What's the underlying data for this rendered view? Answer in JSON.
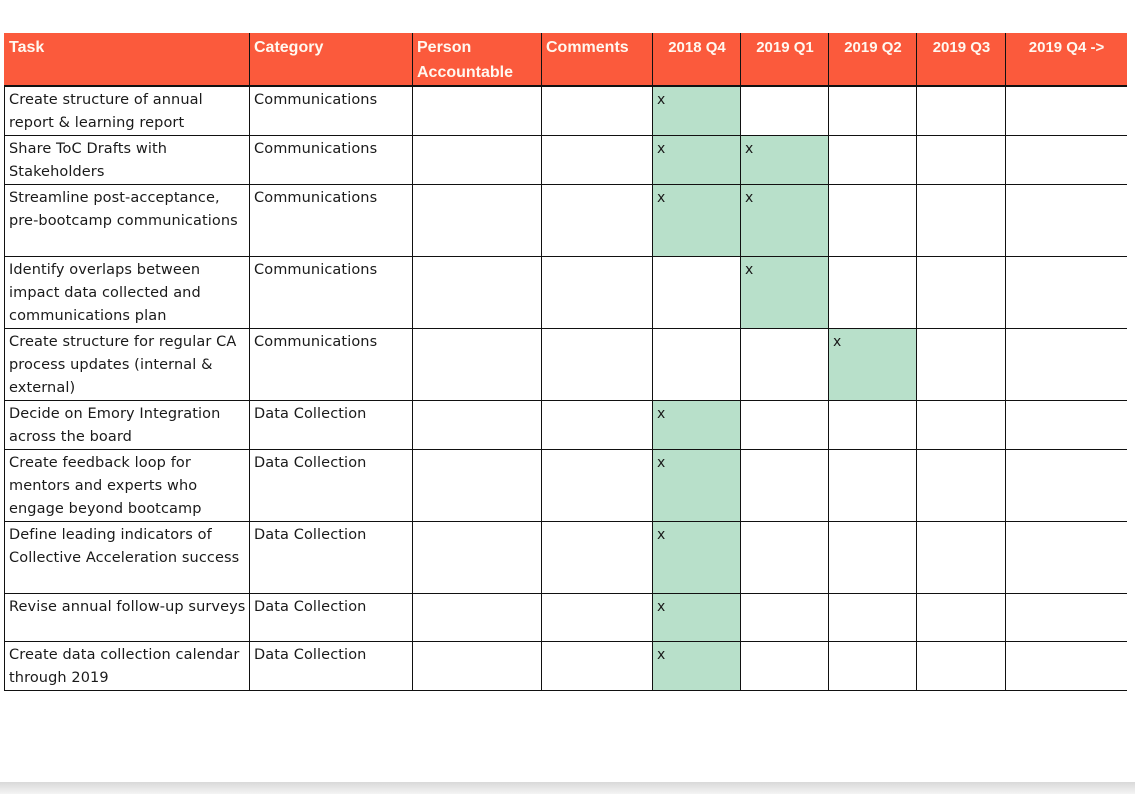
{
  "header": {
    "task": "Task",
    "category": "Category",
    "person": "Person Accountable",
    "comments": "Comments",
    "quarters": [
      "2018 Q4",
      "2019 Q1",
      "2019 Q2",
      "2019 Q3",
      "2019 Q4 ->"
    ]
  },
  "colors": {
    "header_bg": "#fb5a3c",
    "header_text": "#fff8f0",
    "scheduled_cell": "#b8e0ca",
    "grid": "#111111"
  },
  "mark_symbol": "x",
  "rows": [
    {
      "task": "Create structure of annual report & learning report",
      "category": "Communications",
      "person": "",
      "comments": "",
      "marks": [
        true,
        false,
        false,
        false,
        false
      ]
    },
    {
      "task": "Share ToC Drafts with Stakeholders",
      "category": "Communications",
      "person": "",
      "comments": "",
      "marks": [
        true,
        true,
        false,
        false,
        false
      ]
    },
    {
      "task": "Streamline post-acceptance, pre-bootcamp communications",
      "category": "Communications",
      "person": "",
      "comments": "",
      "marks": [
        true,
        true,
        false,
        false,
        false
      ]
    },
    {
      "task": "Identify overlaps between impact data collected and communications plan",
      "category": "Communications",
      "person": "",
      "comments": "",
      "marks": [
        false,
        true,
        false,
        false,
        false
      ]
    },
    {
      "task": "Create structure for regular CA process updates (internal & external)",
      "category": "Communications",
      "person": "",
      "comments": "",
      "marks": [
        false,
        false,
        true,
        false,
        false
      ]
    },
    {
      "task": "Decide on Emory Integration across the board",
      "category": "Data Collection",
      "person": "",
      "comments": "",
      "marks": [
        true,
        false,
        false,
        false,
        false
      ]
    },
    {
      "task": "Create feedback loop for mentors and experts who engage beyond bootcamp",
      "category": "Data Collection",
      "person": "",
      "comments": "",
      "marks": [
        true,
        false,
        false,
        false,
        false
      ]
    },
    {
      "task": "Define leading indicators of Collective Acceleration success",
      "category": "Data Collection",
      "person": "",
      "comments": "",
      "marks": [
        true,
        false,
        false,
        false,
        false
      ]
    },
    {
      "task": "Revise annual follow-up surveys",
      "category": "Data Collection",
      "person": "",
      "comments": "",
      "marks": [
        true,
        false,
        false,
        false,
        false
      ]
    },
    {
      "task": "Create data collection calendar through 2019",
      "category": "Data Collection",
      "person": "",
      "comments": "",
      "marks": [
        true,
        false,
        false,
        false,
        false
      ]
    }
  ]
}
